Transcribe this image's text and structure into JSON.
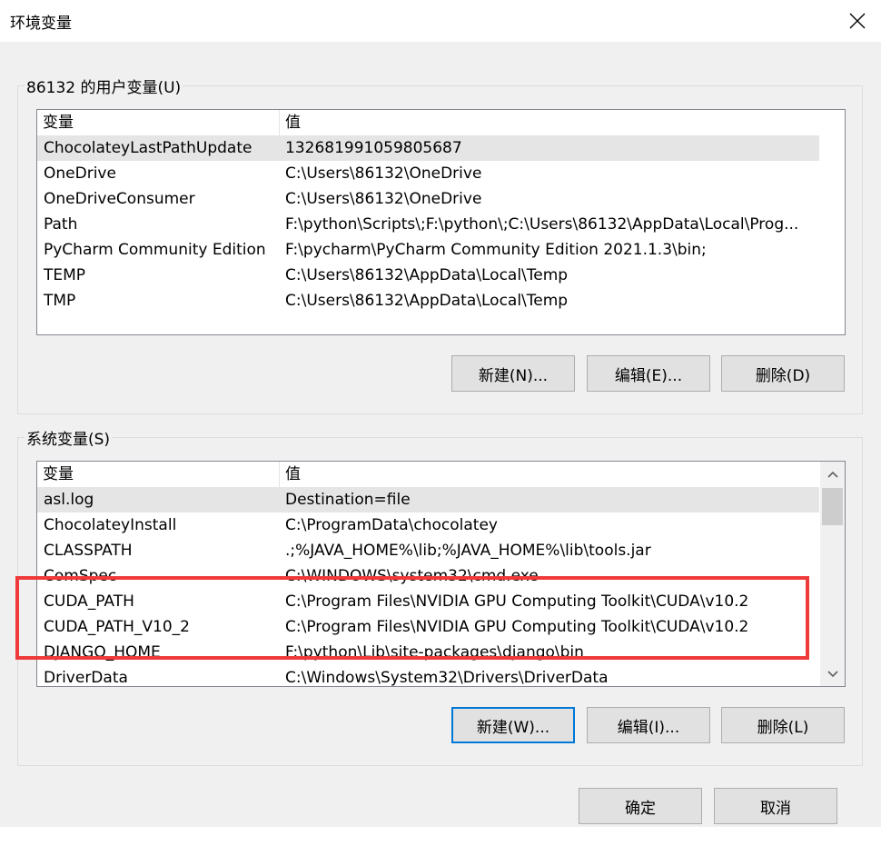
{
  "window": {
    "title": "环境变量",
    "close_icon": "close-icon"
  },
  "user_vars": {
    "label": "86132 的用户变量(U)",
    "headers": {
      "variable": "变量",
      "value": "值"
    },
    "rows": [
      {
        "name": "ChocolateyLastPathUpdate",
        "value": "132681991059805687"
      },
      {
        "name": "OneDrive",
        "value": "C:\\Users\\86132\\OneDrive"
      },
      {
        "name": "OneDriveConsumer",
        "value": "C:\\Users\\86132\\OneDrive"
      },
      {
        "name": "Path",
        "value": "F:\\python\\Scripts\\;F:\\python\\;C:\\Users\\86132\\AppData\\Local\\Prog..."
      },
      {
        "name": "PyCharm Community Edition",
        "value": "F:\\pycharm\\PyCharm Community Edition 2021.1.3\\bin;"
      },
      {
        "name": "TEMP",
        "value": "C:\\Users\\86132\\AppData\\Local\\Temp"
      },
      {
        "name": "TMP",
        "value": "C:\\Users\\86132\\AppData\\Local\\Temp"
      }
    ],
    "buttons": {
      "new": "新建(N)...",
      "edit": "编辑(E)...",
      "delete": "删除(D)"
    }
  },
  "system_vars": {
    "label": "系统变量(S)",
    "headers": {
      "variable": "变量",
      "value": "值"
    },
    "rows": [
      {
        "name": "asl.log",
        "value": "Destination=file"
      },
      {
        "name": "ChocolateyInstall",
        "value": "C:\\ProgramData\\chocolatey"
      },
      {
        "name": "CLASSPATH",
        "value": ".;%JAVA_HOME%\\lib;%JAVA_HOME%\\lib\\tools.jar"
      },
      {
        "name": "ComSpec",
        "value": "C:\\WINDOWS\\system32\\cmd.exe"
      },
      {
        "name": "CUDA_PATH",
        "value": "C:\\Program Files\\NVIDIA GPU Computing Toolkit\\CUDA\\v10.2"
      },
      {
        "name": "CUDA_PATH_V10_2",
        "value": "C:\\Program Files\\NVIDIA GPU Computing Toolkit\\CUDA\\v10.2"
      },
      {
        "name": "DJANGO_HOME",
        "value": "F:\\python\\Lib\\site-packages\\django\\bin"
      },
      {
        "name": "DriverData",
        "value": "C:\\Windows\\System32\\Drivers\\DriverData"
      }
    ],
    "buttons": {
      "new": "新建(W)...",
      "edit": "编辑(I)...",
      "delete": "删除(L)"
    }
  },
  "footer": {
    "ok": "确定",
    "cancel": "取消"
  },
  "colors": {
    "annotation": "#ee3a3a",
    "default_button_border": "#0078d7"
  }
}
